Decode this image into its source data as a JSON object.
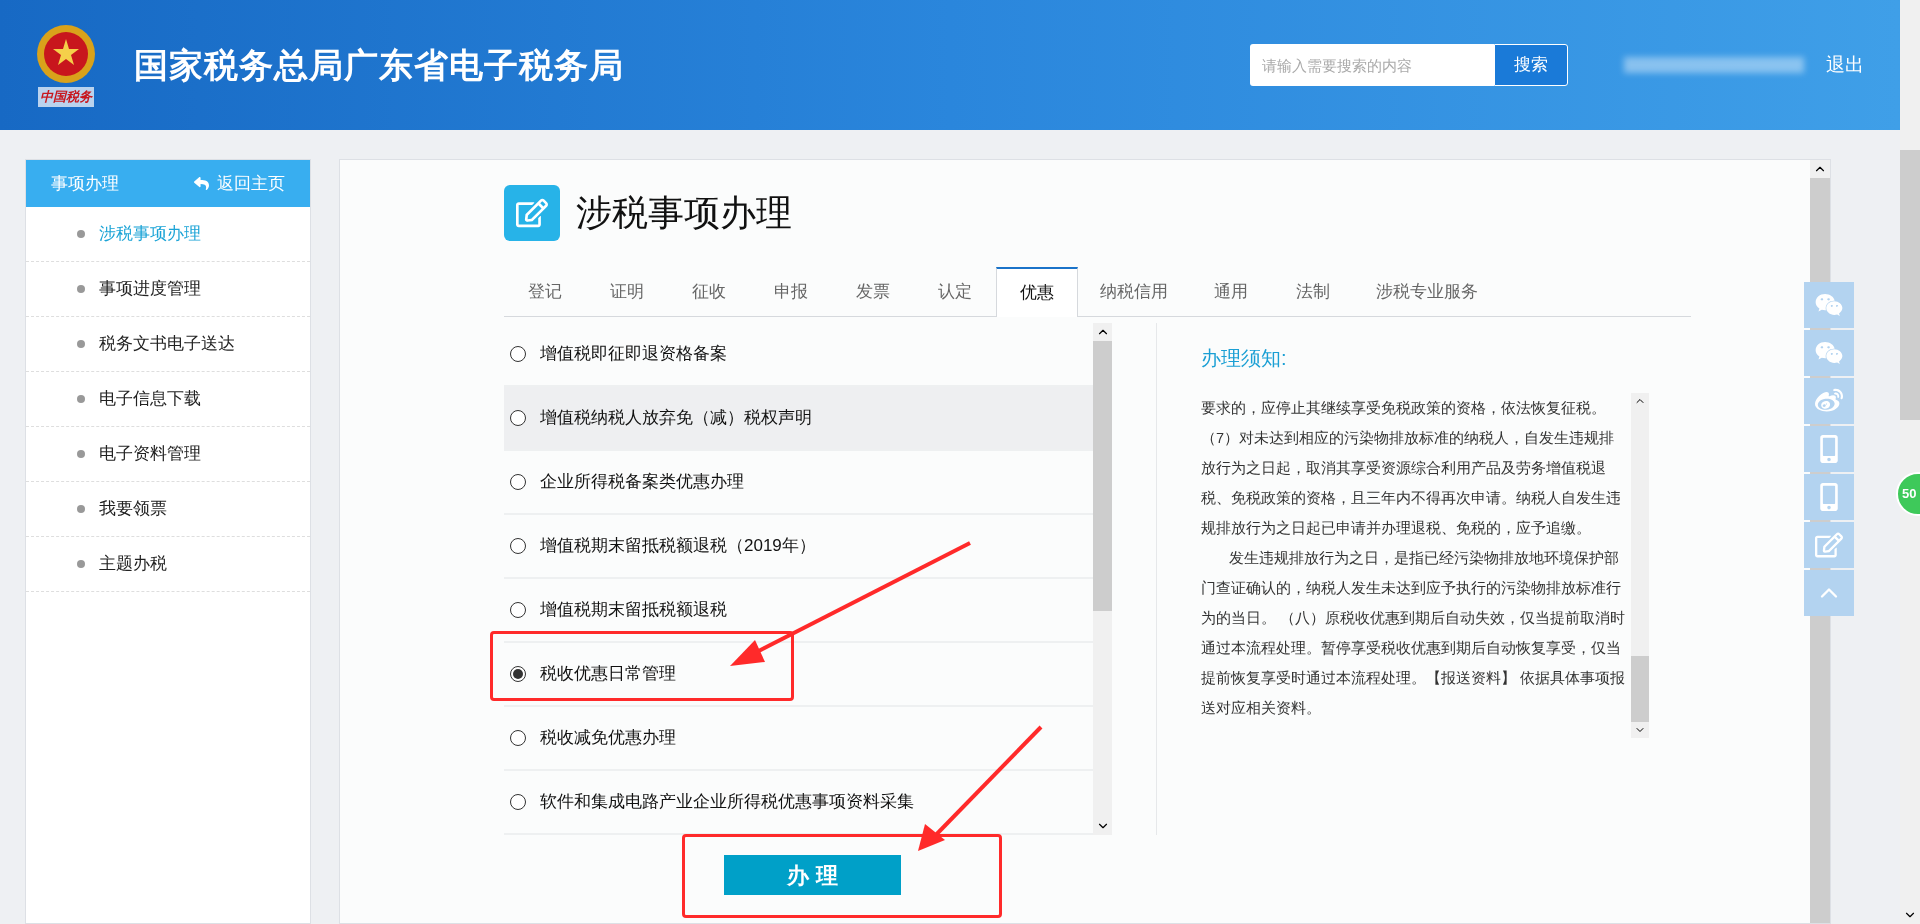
{
  "header": {
    "logo_caption": "中国税务",
    "title": "国家税务总局广东省电子税务局",
    "search": {
      "placeholder": "请输入需要搜索的内容",
      "button": "搜索"
    },
    "logout": "退出"
  },
  "sidebar": {
    "title": "事项办理",
    "back": "返回主页",
    "items": [
      {
        "label": "涉税事项办理",
        "selected": true
      },
      {
        "label": "事项进度管理",
        "selected": false
      },
      {
        "label": "税务文书电子送达",
        "selected": false
      },
      {
        "label": "电子信息下载",
        "selected": false
      },
      {
        "label": "电子资料管理",
        "selected": false
      },
      {
        "label": "我要领票",
        "selected": false
      },
      {
        "label": "主题办税",
        "selected": false
      }
    ]
  },
  "page_title": "涉税事项办理",
  "tabs": [
    {
      "label": "登记",
      "selected": false
    },
    {
      "label": "证明",
      "selected": false
    },
    {
      "label": "征收",
      "selected": false
    },
    {
      "label": "申报",
      "selected": false
    },
    {
      "label": "发票",
      "selected": false
    },
    {
      "label": "认定",
      "selected": false
    },
    {
      "label": "优惠",
      "selected": true
    },
    {
      "label": "纳税信用",
      "selected": false
    },
    {
      "label": "通用",
      "selected": false
    },
    {
      "label": "法制",
      "selected": false
    },
    {
      "label": "涉税专业服务",
      "selected": false
    }
  ],
  "options": [
    {
      "label": "增值税即征即退资格备案",
      "selected": false,
      "highlighted": false
    },
    {
      "label": "增值税纳税人放弃免（减）税权声明",
      "selected": false,
      "highlighted": true
    },
    {
      "label": "企业所得税备案类优惠办理",
      "selected": false,
      "highlighted": false
    },
    {
      "label": "增值税期末留抵税额退税（2019年）",
      "selected": false,
      "highlighted": false
    },
    {
      "label": "增值税期末留抵税额退税",
      "selected": false,
      "highlighted": false
    },
    {
      "label": "税收优惠日常管理",
      "selected": true,
      "highlighted": false
    },
    {
      "label": "税收减免优惠办理",
      "selected": false,
      "highlighted": false
    },
    {
      "label": "软件和集成电路产业企业所得税优惠事项资料采集",
      "selected": false,
      "highlighted": false
    }
  ],
  "submit_button": "办 理",
  "notice": {
    "title": "办理须知:",
    "paragraphs": [
      {
        "text": "要求的，应停止其继续享受免税政策的资格，依法恢复征税。",
        "indent": false
      },
      {
        "text": "（7）对未达到相应的污染物排放标准的纳税人，自发生违规排放行为之日起，取消其享受资源综合利用产品及劳务增值税退税、免税政策的资格，且三年内不得再次申请。纳税人自发生违规排放行为之日起已申请并办理退税、免税的，应予追缴。",
        "indent": false
      },
      {
        "text": "发生违规排放行为之日，是指已经污染物排放地环境保护部门查证确认的，纳税人发生未达到应予执行的污染物排放标准行为的当日。 （八）原税收优惠到期后自动失效，仅当提前取消时通过本流程处理。暂停享受税收优惠到期后自动恢复享受，仅当提前恢复享受时通过本流程处理。【报送资料】 依据具体事项报送对应相关资料。",
        "indent": true
      }
    ]
  },
  "float_badge": "50"
}
